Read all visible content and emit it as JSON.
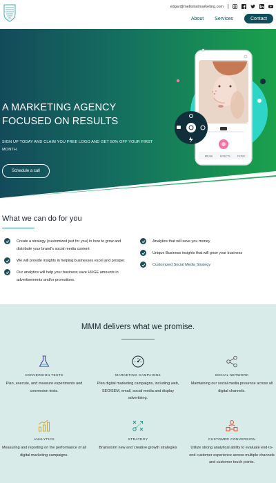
{
  "header": {
    "email": "edgar@mellonistmarketing.com",
    "social_icons": [
      "instagram-icon",
      "facebook-icon",
      "twitter-icon",
      "linkedin-icon",
      "youtube-icon"
    ],
    "nav": [
      "About",
      "Services"
    ],
    "contact_label": "Contact"
  },
  "hero": {
    "title_line1": "A MARKETING AGENCY",
    "title_line2": "FOCUSED ON RESULTS",
    "subtitle": "SIGN UP TODAY AND CLAIM YOU FREE LOGO AND GET 50% OFF YOUR FIRST MONTH.",
    "cta_label": "Schedule a call",
    "phone_tabs": [
      "BRUSH",
      "EFFECTS",
      "FILTER"
    ]
  },
  "what_we_do": {
    "title": "What we can do for you",
    "left": [
      "Create a strategy (customized just for you) in how to grow and distribute your brand's social media content",
      "We will provide insights in helping businesses excel and prosper.",
      "Our analytics will help your business save HUGE amounts in advertisements and/or promotions."
    ],
    "right": [
      "Analytics that will save you money",
      "Unique Business insights that will grow your business",
      "Customized Social Media Strategy"
    ]
  },
  "promise": {
    "title": "MMM delivers what we promise.",
    "services": [
      {
        "label": "CONVERSION TESTS",
        "desc": "Plan, execute, and measure experiments and conversion tests.",
        "icon": "flask-icon"
      },
      {
        "label": "MARKETING CAMPAIGNS",
        "desc": "Plan digital marketing campaigns, including web, SEO/SEM, email, social media and display advertising.",
        "icon": "gauge-icon"
      },
      {
        "label": "SOCIAL NETWORK",
        "desc": "Maintaining our social media presence across all digital channels.",
        "icon": "network-icon"
      },
      {
        "label": "ANALYTICS",
        "desc": "Measuring and reporting on the performance of all digital marketing campaigns.",
        "icon": "bar-chart-icon"
      },
      {
        "label": "STRATEGY",
        "desc": "Brainstorm new and creative growth strategies",
        "icon": "strategy-icon"
      },
      {
        "label": "CUSTOMER CONVERSION",
        "desc": "Utilize strong analytical ability to evaluate end-to-end customer experience across multiple channels and customer touch points.",
        "icon": "customer-icon"
      }
    ]
  },
  "colors": {
    "brand_dark": "#0f4e5a",
    "accent_green": "#1aa35a",
    "accent_teal": "#2d8c86",
    "section_bg": "#d9ebe9"
  }
}
